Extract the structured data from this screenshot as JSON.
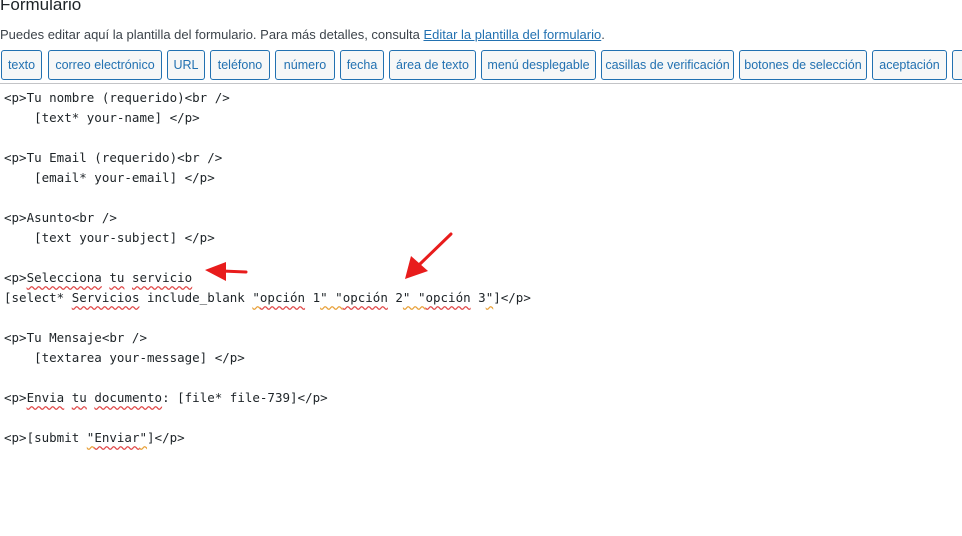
{
  "page": {
    "title": "Formulario",
    "intro_text": "Puedes editar aquí la plantilla del formulario. Para más detalles, consulta ",
    "intro_link": "Editar la plantilla del formulario",
    "intro_end": "."
  },
  "tags": [
    "texto",
    "correo electrónico",
    "URL",
    "teléfono",
    "número",
    "fecha",
    "área de texto",
    "menú desplegable",
    "casillas de verificación",
    "botones de selección",
    "aceptación"
  ],
  "code": {
    "l1": "<p>Tu nombre (requerido)<br />",
    "l2": "    [text* your-name] </p>",
    "l3": "<p>Tu Email (requerido)<br />",
    "l4": "    [email* your-email] </p>",
    "l5": "<p>Asunto<br />",
    "l6": "    [text your-subject] </p>",
    "l7_a": "<p>",
    "l7_b": "Selecciona",
    "l7_c": " ",
    "l7_d": "tu",
    "l7_e": " ",
    "l7_f": "servicio",
    "l8_a": "[select* ",
    "l8_b": "Servicios",
    "l8_c": " include_blank ",
    "l8_d": "\"",
    "l8_e": "opción",
    "l8_f": " 1",
    "l8_g": "\" \"",
    "l8_h": "opción",
    "l8_i": " 2",
    "l8_j": "\" \"",
    "l8_k": "opción",
    "l8_l": " 3",
    "l8_m": "\"",
    "l8_n": "]</p>",
    "l9": "<p>Tu Mensaje<br />",
    "l10": "    [textarea your-message] </p>",
    "l11_a": "<p>",
    "l11_b": "Envia",
    "l11_c": " ",
    "l11_d": "tu",
    "l11_e": " ",
    "l11_f": "documento",
    "l11_g": ": [file* file-739]</p>",
    "l12_a": "<p>[submit ",
    "l12_b": "\"",
    "l12_c": "Enviar",
    "l12_d": "\"",
    "l12_e": "]</p>"
  },
  "colors": {
    "annotation_arrow": "#e81c1c",
    "spell_error": "#e04a4a",
    "grammar_hint": "#e8a13a",
    "tag_accent": "#2271b1"
  }
}
